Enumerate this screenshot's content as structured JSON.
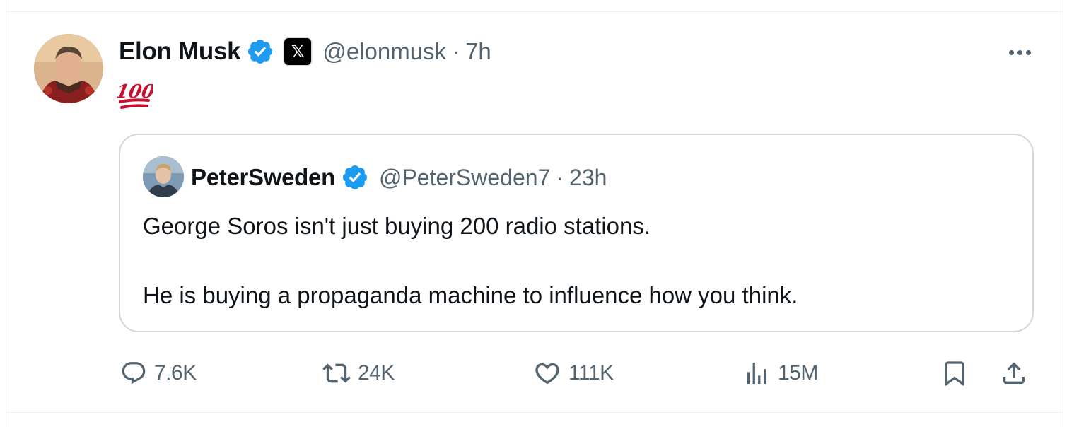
{
  "author": {
    "display_name": "Elon Musk",
    "handle": "@elonmusk",
    "separator": "·",
    "time": "7h",
    "affiliation_label": "𝕏"
  },
  "tweet": {
    "text": "💯"
  },
  "quoted": {
    "display_name": "PeterSweden",
    "handle": "@PeterSweden7",
    "separator": "·",
    "time": "23h",
    "line1": "George Soros isn't just buying 200 radio stations.",
    "line2": "He is buying a propaganda machine to influence how you think."
  },
  "actions": {
    "replies": "7.6K",
    "reposts": "24K",
    "likes": "111K",
    "views": "15M"
  },
  "icons": {
    "verified": "verified-badge-icon",
    "more": "more-icon",
    "reply": "reply-icon",
    "repost": "repost-icon",
    "like": "like-icon",
    "views": "views-icon",
    "bookmark": "bookmark-icon",
    "share": "share-icon"
  },
  "colors": {
    "verified_blue": "#1d9bf0",
    "secondary_text": "#536471",
    "primary_text": "#0f1419",
    "border": "#cfd9de",
    "emoji_red": "#c8102e"
  }
}
